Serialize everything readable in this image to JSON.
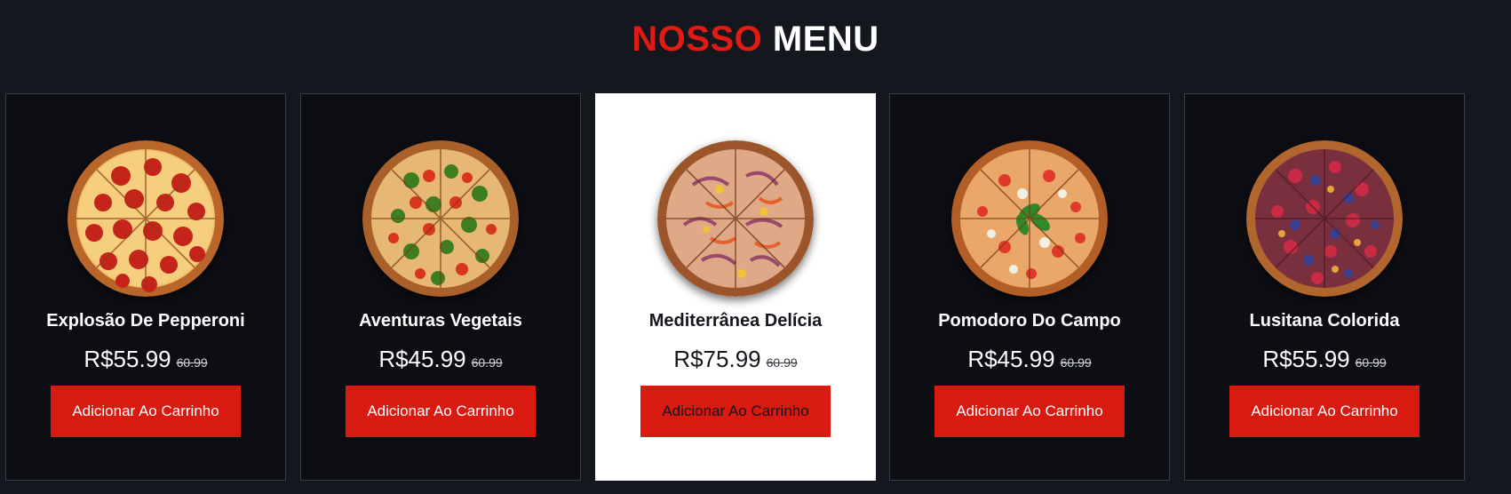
{
  "header": {
    "title_accent": "NOSSO",
    "title_rest": "MENU"
  },
  "colors": {
    "accent": "#e01b14",
    "button": "#d81a10",
    "background": "#14171d",
    "card": "#0c0e13",
    "active_card": "#ffffff"
  },
  "menu": {
    "items": [
      {
        "name": "Explosão De Pepperoni",
        "price": "R$55.99",
        "old_price": "60.99",
        "button_label": "Adicionar Ao Carrinho",
        "image_icon": "pepperoni-pizza-icon"
      },
      {
        "name": "Aventuras Vegetais",
        "price": "R$45.99",
        "old_price": "60.99",
        "button_label": "Adicionar Ao Carrinho",
        "image_icon": "vegetable-pizza-icon"
      },
      {
        "name": "Mediterrânea Delícia",
        "price": "R$75.99",
        "old_price": "60.99",
        "button_label": "Adicionar Ao Carrinho",
        "image_icon": "mediterranean-pizza-icon"
      },
      {
        "name": "Pomodoro Do Campo",
        "price": "R$45.99",
        "old_price": "60.99",
        "button_label": "Adicionar Ao Carrinho",
        "image_icon": "tomato-basil-pizza-icon"
      },
      {
        "name": "Lusitana Colorida",
        "price": "R$55.99",
        "old_price": "60.99",
        "button_label": "Adicionar Ao Carrinho",
        "image_icon": "berry-pizza-icon"
      }
    ]
  }
}
